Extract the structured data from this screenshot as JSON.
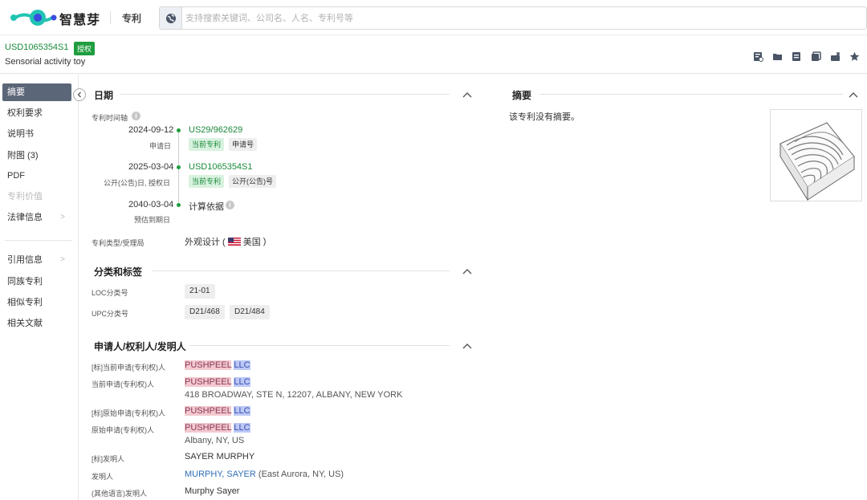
{
  "app": {
    "logo_text": "智慧芽",
    "module": "专利"
  },
  "search": {
    "placeholder": "支持搜索关键词、公司名、人名、专利号等"
  },
  "patent": {
    "number": "USD1065354S1",
    "status": "授权",
    "title": "Sensorial activity toy"
  },
  "toolbar": {
    "icons": [
      "pdf-download-icon",
      "folder-icon",
      "report-icon",
      "copy-icon",
      "share-icon",
      "star-icon"
    ]
  },
  "sidebar": {
    "items": [
      {
        "label": "摘要"
      },
      {
        "label": "权利要求"
      },
      {
        "label": "说明书"
      },
      {
        "label": "附图 (3)"
      },
      {
        "label": "PDF"
      },
      {
        "label": "专利价值"
      },
      {
        "label": "法律信息"
      },
      {
        "label": "引用信息"
      },
      {
        "label": "同族专利"
      },
      {
        "label": "相似专利"
      },
      {
        "label": "相关文献"
      }
    ]
  },
  "dates": {
    "section_title": "日期",
    "timeline_label": "专利时间轴",
    "events": [
      {
        "date": "2024-09-12",
        "sublabel": "申请日",
        "number": "US29/962629",
        "tags": [
          "当前专利",
          "申请号"
        ]
      },
      {
        "date": "2025-03-04",
        "sublabel": "公开(公告)日, 授权日",
        "number": "USD1065354S1",
        "tags": [
          "当前专利",
          "公开(公告)号"
        ]
      },
      {
        "date": "2040-03-04",
        "sublabel": "预估到期日",
        "text": "计算依据"
      }
    ],
    "type_label": "专利类型/受理局",
    "type_value": "外观设计 (",
    "country": "美国",
    "type_close": ")"
  },
  "classification": {
    "section_title": "分类和标签",
    "loc_label": "LOC分类号",
    "loc": [
      "21-01"
    ],
    "upc_label": "UPC分类号",
    "upc": [
      "D21/468",
      "D21/484"
    ]
  },
  "parties": {
    "section_title": "申请人/权利人/发明人",
    "rows": [
      {
        "label": "[标]当前申请(专利权)人",
        "name_a": "PUSHPEEL",
        "name_b": "LLC"
      },
      {
        "label": "当前申请(专利权)人",
        "name_a": "PUSHPEEL",
        "name_b": "LLC",
        "address": "418 BROADWAY, STE N, 12207, ALBANY, NEW YORK"
      },
      {
        "label": "[标]原始申请(专利权)人",
        "name_a": "PUSHPEEL",
        "name_b": "LLC"
      },
      {
        "label": "原始申请(专利权)人",
        "name_a": "PUSHPEEL",
        "name_b": "LLC",
        "address": "Albany, NY, US"
      },
      {
        "label": "[标]发明人",
        "value": "SAYER MURPHY"
      },
      {
        "label": "发明人",
        "link": "MURPHY, SAYER",
        "extra": "(East Aurora, NY, US)"
      },
      {
        "label": "(其他语言)发明人",
        "value": "Murphy Sayer"
      }
    ]
  },
  "abstract": {
    "section_title": "摘要",
    "text": "该专利没有摘要。"
  },
  "colors": {
    "brand_green": "#1f9d3f",
    "logo_teal": "#21c4b2",
    "logo_blue": "#3a4de0",
    "link_blue": "#2f6fb5",
    "active_nav": "#5b6678"
  }
}
